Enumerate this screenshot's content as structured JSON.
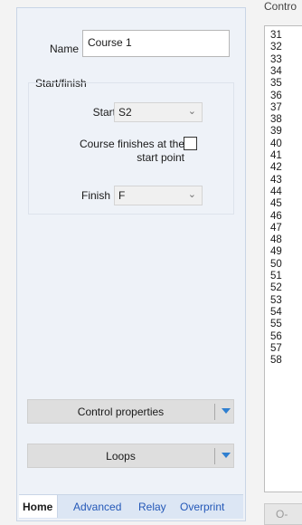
{
  "course": {
    "name_label": "Name",
    "name_value": "Course 1"
  },
  "start_finish": {
    "header": "Start/finish",
    "start_label": "Start",
    "start_value": "S2",
    "same_point_line1": "Course finishes at the",
    "same_point_line2": "start point",
    "finish_label": "Finish",
    "finish_value": "F"
  },
  "buttons": {
    "control_properties": "Control properties",
    "loops": "Loops"
  },
  "tabs": [
    "Home",
    "Advanced",
    "Relay",
    "Overprint"
  ],
  "controls": {
    "header": "Contro",
    "items": [
      "31",
      "32",
      "33",
      "34",
      "35",
      "36",
      "37",
      "38",
      "39",
      "40",
      "41",
      "42",
      "43",
      "44",
      "45",
      "46",
      "47",
      "48",
      "49",
      "50",
      "51",
      "52",
      "53",
      "54",
      "55",
      "56",
      "57",
      "58"
    ],
    "button_label": "O-"
  }
}
